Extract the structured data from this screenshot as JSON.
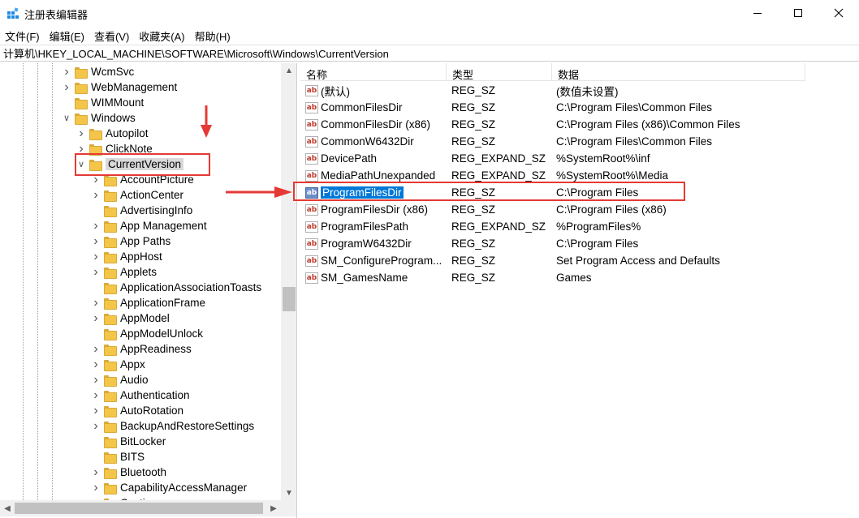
{
  "app": {
    "title": "注册表编辑器"
  },
  "menu": [
    "文件(F)",
    "编辑(E)",
    "查看(V)",
    "收藏夹(A)",
    "帮助(H)"
  ],
  "address": {
    "path": "计算机\\HKEY_LOCAL_MACHINE\\SOFTWARE\\Microsoft\\Windows\\CurrentVersion"
  },
  "tree": [
    {
      "label": "WcmSvc",
      "level": 1,
      "expander": "collapsed"
    },
    {
      "label": "WebManagement",
      "level": 1,
      "expander": "collapsed"
    },
    {
      "label": "WIMMount",
      "level": 1,
      "expander": "none"
    },
    {
      "label": "Windows",
      "level": 1,
      "expander": "expanded"
    },
    {
      "label": "Autopilot",
      "level": 2,
      "expander": "collapsed"
    },
    {
      "label": "ClickNote",
      "level": 2,
      "expander": "collapsed"
    },
    {
      "label": "CurrentVersion",
      "level": 2,
      "expander": "expanded",
      "selected": true
    },
    {
      "label": "AccountPicture",
      "level": 3,
      "expander": "collapsed"
    },
    {
      "label": "ActionCenter",
      "level": 3,
      "expander": "collapsed"
    },
    {
      "label": "AdvertisingInfo",
      "level": 3,
      "expander": "none"
    },
    {
      "label": "App Management",
      "level": 3,
      "expander": "collapsed"
    },
    {
      "label": "App Paths",
      "level": 3,
      "expander": "collapsed"
    },
    {
      "label": "AppHost",
      "level": 3,
      "expander": "collapsed"
    },
    {
      "label": "Applets",
      "level": 3,
      "expander": "collapsed"
    },
    {
      "label": "ApplicationAssociationToasts",
      "level": 3,
      "expander": "none"
    },
    {
      "label": "ApplicationFrame",
      "level": 3,
      "expander": "collapsed"
    },
    {
      "label": "AppModel",
      "level": 3,
      "expander": "collapsed"
    },
    {
      "label": "AppModelUnlock",
      "level": 3,
      "expander": "none"
    },
    {
      "label": "AppReadiness",
      "level": 3,
      "expander": "collapsed"
    },
    {
      "label": "Appx",
      "level": 3,
      "expander": "collapsed"
    },
    {
      "label": "Audio",
      "level": 3,
      "expander": "collapsed"
    },
    {
      "label": "Authentication",
      "level": 3,
      "expander": "collapsed"
    },
    {
      "label": "AutoRotation",
      "level": 3,
      "expander": "collapsed"
    },
    {
      "label": "BackupAndRestoreSettings",
      "level": 3,
      "expander": "collapsed"
    },
    {
      "label": "BitLocker",
      "level": 3,
      "expander": "none"
    },
    {
      "label": "BITS",
      "level": 3,
      "expander": "none"
    },
    {
      "label": "Bluetooth",
      "level": 3,
      "expander": "collapsed"
    },
    {
      "label": "CapabilityAccessManager",
      "level": 3,
      "expander": "collapsed"
    },
    {
      "label": "Casting",
      "level": 3,
      "expander": "collapsed"
    }
  ],
  "list": {
    "headers": {
      "name": "名称",
      "type": "类型",
      "data": "数据"
    },
    "rows": [
      {
        "name": "(默认)",
        "type": "REG_SZ",
        "data": "(数值未设置)"
      },
      {
        "name": "CommonFilesDir",
        "type": "REG_SZ",
        "data": "C:\\Program Files\\Common Files"
      },
      {
        "name": "CommonFilesDir (x86)",
        "type": "REG_SZ",
        "data": "C:\\Program Files (x86)\\Common Files"
      },
      {
        "name": "CommonW6432Dir",
        "type": "REG_SZ",
        "data": "C:\\Program Files\\Common Files"
      },
      {
        "name": "DevicePath",
        "type": "REG_EXPAND_SZ",
        "data": "%SystemRoot%\\inf"
      },
      {
        "name": "MediaPathUnexpanded",
        "type": "REG_EXPAND_SZ",
        "data": "%SystemRoot%\\Media"
      },
      {
        "name": "ProgramFilesDir",
        "type": "REG_SZ",
        "data": "C:\\Program Files",
        "selected": true
      },
      {
        "name": "ProgramFilesDir (x86)",
        "type": "REG_SZ",
        "data": "C:\\Program Files (x86)"
      },
      {
        "name": "ProgramFilesPath",
        "type": "REG_EXPAND_SZ",
        "data": "%ProgramFiles%"
      },
      {
        "name": "ProgramW6432Dir",
        "type": "REG_SZ",
        "data": "C:\\Program Files"
      },
      {
        "name": "SM_ConfigureProgram...",
        "type": "REG_SZ",
        "data": "Set Program Access and Defaults"
      },
      {
        "name": "SM_GamesName",
        "type": "REG_SZ",
        "data": "Games"
      }
    ],
    "value_icon": "ab"
  },
  "colors": {
    "annotation": "#e53935",
    "selection": "#0078d7",
    "folder": "#f3c64a"
  }
}
